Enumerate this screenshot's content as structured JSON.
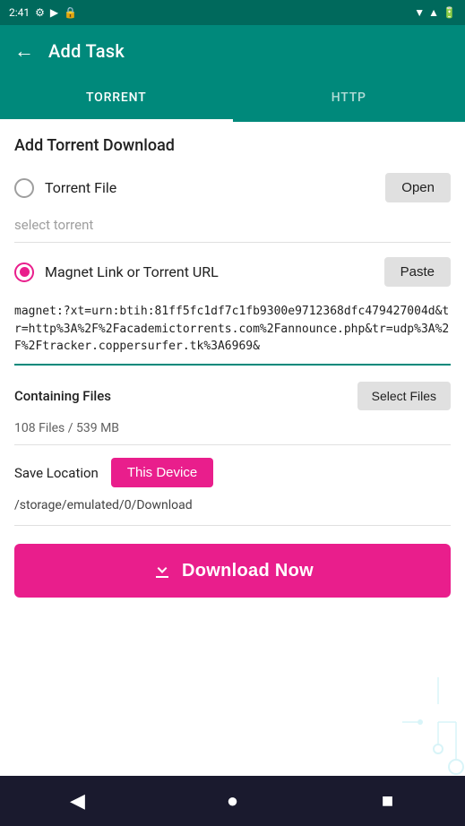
{
  "statusBar": {
    "time": "2:41",
    "icons": [
      "settings",
      "play",
      "lock"
    ]
  },
  "appBar": {
    "backLabel": "←",
    "title": "Add Task"
  },
  "tabs": [
    {
      "id": "torrent",
      "label": "TORRENT",
      "active": true
    },
    {
      "id": "http",
      "label": "HTTP",
      "active": false
    }
  ],
  "section": {
    "title": "Add Torrent Download"
  },
  "torrentFile": {
    "label": "Torrent File",
    "btnLabel": "Open",
    "placeholder": "select torrent"
  },
  "magnetLink": {
    "label": "Magnet Link or Torrent URL",
    "btnLabel": "Paste",
    "value": "magnet:?xt=urn:btih:81ff5fc1df7c1fb9300e9712368dfc479427004d&tr=http%3A%2F%2Facademictorrents.com%2Fannounce.php&tr=udp%3A%2F%2Ftracker.coppersurfer.tk%3A6969&"
  },
  "containingFiles": {
    "label": "Containing Files",
    "btnLabel": "Select Files",
    "count": "108 Files / 539 MB"
  },
  "saveLocation": {
    "label": "Save Location",
    "btnLabel": "This Device",
    "path": "/storage/emulated/0/Download"
  },
  "downloadBtn": {
    "label": "Download Now"
  },
  "bottomNav": {
    "back": "◀",
    "home": "●",
    "recent": "■"
  }
}
